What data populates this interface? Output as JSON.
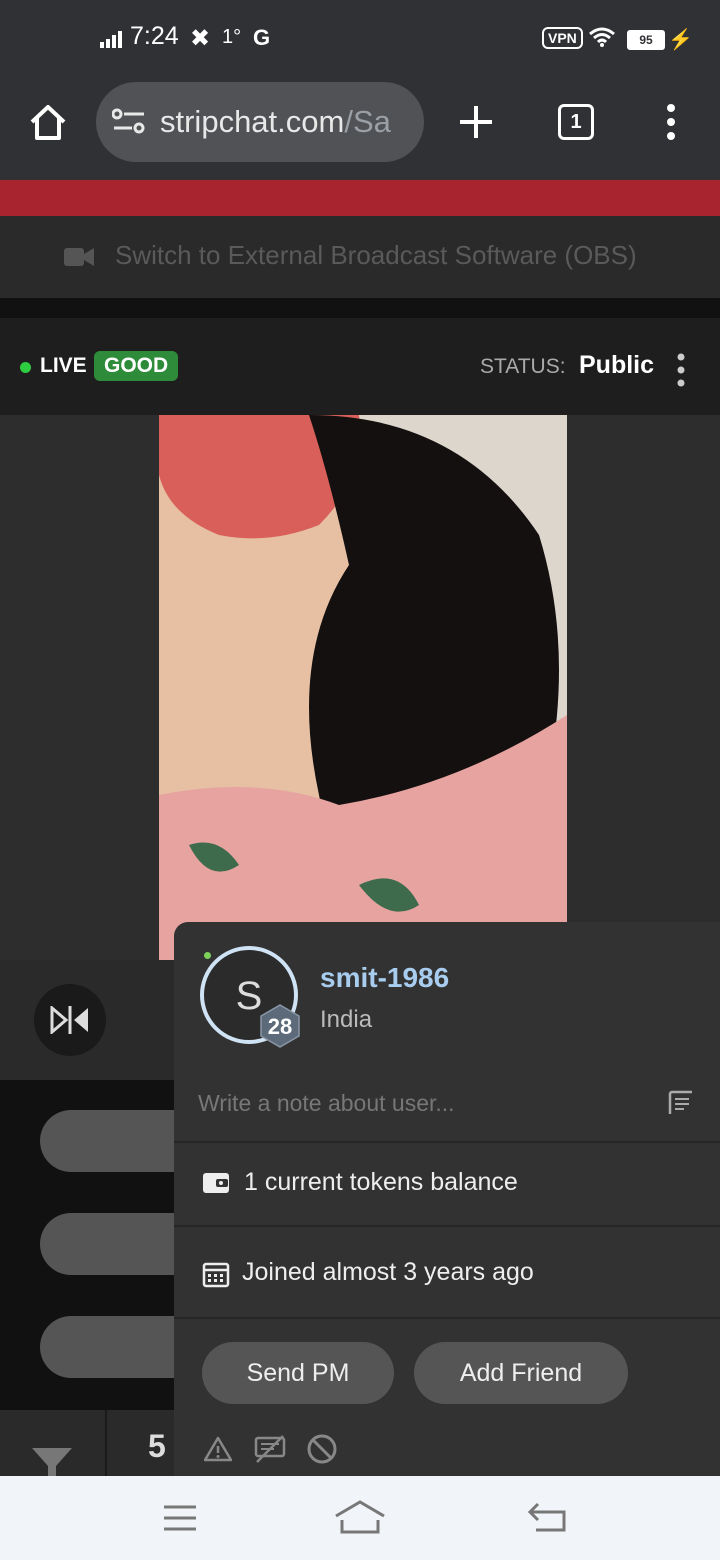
{
  "status_bar": {
    "time": "7:24",
    "temp": "1°",
    "network": "G",
    "vpn": "VPN",
    "battery": "95"
  },
  "browser": {
    "url_main": "stripchat.com",
    "url_rest": "/Sa",
    "tab_count": "1"
  },
  "obs": {
    "label": "Switch to External Broadcast Software (OBS)"
  },
  "live_bar": {
    "live": "LIVE",
    "quality": "GOOD",
    "status_label": "STATUS:",
    "status_value": "Public"
  },
  "bottom": {
    "count": "5"
  },
  "user_popup": {
    "avatar_letter": "S",
    "level": "28",
    "username": "smit-1986",
    "country": "India",
    "note_placeholder": "Write a note about user...",
    "tokens": "1 current tokens balance",
    "joined": "Joined almost 3 years ago",
    "send_pm": "Send PM",
    "add_friend": "Add Friend"
  },
  "colors": {
    "accent_red": "#a8242e",
    "good_green": "#2e8b3a",
    "username": "#a8cdee"
  }
}
